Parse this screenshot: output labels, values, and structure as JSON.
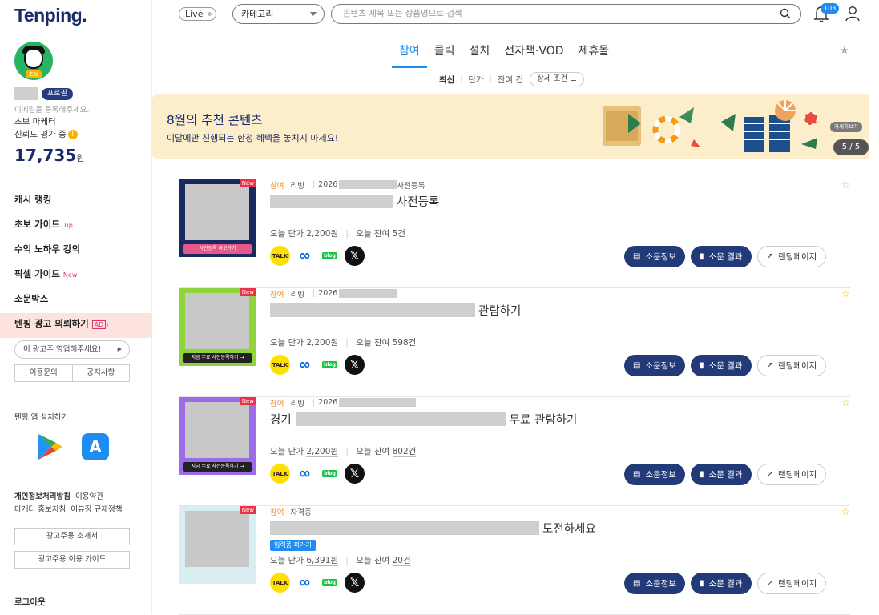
{
  "brand": {
    "logo": "Tenping."
  },
  "profile": {
    "role_tag": "프로필",
    "email_hint": "이메일을 등록해주세요.",
    "level": "초보 마케터",
    "trust": "신뢰도 평가 중",
    "cash_amount": "17,735",
    "cash_unit": "원"
  },
  "sidebar": {
    "menu": [
      {
        "label": "캐시 랭킹",
        "tag": ""
      },
      {
        "label": "초보 가이드",
        "tag": "Tip"
      },
      {
        "label": "수익 노하우 강의",
        "tag": ""
      },
      {
        "label": "픽셀 가이드",
        "tag": "New"
      },
      {
        "label": "소문박스",
        "tag": ""
      },
      {
        "label": "텐핑 광고 의뢰하기",
        "tag": "AD"
      }
    ],
    "sales_prompt": "이 광고주 영업해주세요!",
    "inquiry": "이용문의",
    "notice": "공지사항",
    "app_install": "텐핑 앱 설치하기",
    "privacy": "개인정보처리방침",
    "terms": "이용약관",
    "guideline": "마케터 홍보지침",
    "abuse": "어뷰징 규제정책",
    "advertiser_intro": "광고주용 소개서",
    "advertiser_guide": "광고주용 이용 가이드",
    "logout": "로그아웃"
  },
  "topbar": {
    "live_label": "Live",
    "category_label": "카테고리",
    "search_placeholder": "콘텐츠 제목 또는 상품명으로 검색",
    "notification_count": "103"
  },
  "tabs": [
    "참여",
    "클릭",
    "설치",
    "전자책·VOD",
    "제휴몰"
  ],
  "subtabs": {
    "latest": "최신",
    "price": "단가",
    "remain": "잔여 건",
    "condition": "상세 조건"
  },
  "banner": {
    "title": "8월의 추천 콘텐츠",
    "subtitle": "이달에만 진행되는 한정 혜택을 놓치지 마세요!",
    "more": "자세히보기",
    "page": "5 / 5"
  },
  "cards": [
    {
      "type": "참여",
      "category": "리빙",
      "year": "2026",
      "meta_suffix": "사전등록",
      "title_prefix": "",
      "title_suffix": "사전등록",
      "form_tag": "",
      "price_label": "오늘 단가",
      "price": "2,200원",
      "remain_label": "오늘 잔여",
      "remain": "5건",
      "thumb_bg": "#1a2a5e",
      "thumb_cta": "사전등록 바로가기",
      "cta_color": "#e5588a",
      "new": "New"
    },
    {
      "type": "참여",
      "category": "리빙",
      "year": "2026",
      "meta_suffix": "",
      "title_prefix": "",
      "title_suffix": "관람하기",
      "form_tag": "",
      "price_label": "오늘 단가",
      "price": "2,200원",
      "remain_label": "오늘 잔여",
      "remain": "598건",
      "thumb_bg": "#8fd43a",
      "thumb_cta": "지금 무료 사전등록하기 →",
      "cta_color": "#222222",
      "new": "New"
    },
    {
      "type": "참여",
      "category": "리빙",
      "year": "2026",
      "meta_suffix": "",
      "title_prefix": "경기",
      "title_suffix": "무료 관람하기",
      "form_tag": "",
      "price_label": "오늘 단가",
      "price": "2,200원",
      "remain_label": "오늘 잔여",
      "remain": "802건",
      "thumb_bg": "#9b6be8",
      "thumb_cta": "지금 무료 사전등록하기 →",
      "cta_color": "#222222",
      "new": "New"
    },
    {
      "type": "참여",
      "category": "자격증",
      "year": "",
      "meta_suffix": "",
      "title_prefix": "",
      "title_suffix": "도전하세요",
      "form_tag": "입력폼 펴가기",
      "price_label": "오늘 단가",
      "price": "6,391원",
      "remain_label": "오늘 잔여",
      "remain": "20건",
      "thumb_bg": "#d8eef0",
      "thumb_cta": "",
      "cta_color": "#222222",
      "new": "New"
    }
  ],
  "card_actions": {
    "info": "소문정보",
    "result": "소문 결과",
    "landing": "랜딩페이지"
  },
  "share_labels": {
    "talk": "TALK",
    "blog": "blog"
  },
  "colors": {
    "brand_navy": "#1b2a6b",
    "accent_blue": "#1e8cf0",
    "button_navy": "#223a78",
    "banner_bg": "#fdeecb"
  }
}
